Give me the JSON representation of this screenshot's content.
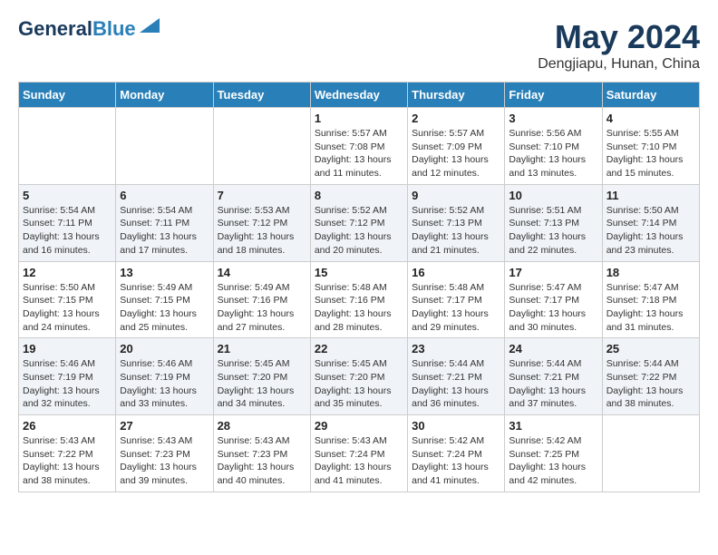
{
  "header": {
    "logo_line1": "General",
    "logo_line2": "Blue",
    "main_title": "May 2024",
    "subtitle": "Dengjiapu, Hunan, China"
  },
  "weekdays": [
    "Sunday",
    "Monday",
    "Tuesday",
    "Wednesday",
    "Thursday",
    "Friday",
    "Saturday"
  ],
  "weeks": [
    [
      {
        "day": "",
        "info": ""
      },
      {
        "day": "",
        "info": ""
      },
      {
        "day": "",
        "info": ""
      },
      {
        "day": "1",
        "info": "Sunrise: 5:57 AM\nSunset: 7:08 PM\nDaylight: 13 hours\nand 11 minutes."
      },
      {
        "day": "2",
        "info": "Sunrise: 5:57 AM\nSunset: 7:09 PM\nDaylight: 13 hours\nand 12 minutes."
      },
      {
        "day": "3",
        "info": "Sunrise: 5:56 AM\nSunset: 7:10 PM\nDaylight: 13 hours\nand 13 minutes."
      },
      {
        "day": "4",
        "info": "Sunrise: 5:55 AM\nSunset: 7:10 PM\nDaylight: 13 hours\nand 15 minutes."
      }
    ],
    [
      {
        "day": "5",
        "info": "Sunrise: 5:54 AM\nSunset: 7:11 PM\nDaylight: 13 hours\nand 16 minutes."
      },
      {
        "day": "6",
        "info": "Sunrise: 5:54 AM\nSunset: 7:11 PM\nDaylight: 13 hours\nand 17 minutes."
      },
      {
        "day": "7",
        "info": "Sunrise: 5:53 AM\nSunset: 7:12 PM\nDaylight: 13 hours\nand 18 minutes."
      },
      {
        "day": "8",
        "info": "Sunrise: 5:52 AM\nSunset: 7:12 PM\nDaylight: 13 hours\nand 20 minutes."
      },
      {
        "day": "9",
        "info": "Sunrise: 5:52 AM\nSunset: 7:13 PM\nDaylight: 13 hours\nand 21 minutes."
      },
      {
        "day": "10",
        "info": "Sunrise: 5:51 AM\nSunset: 7:13 PM\nDaylight: 13 hours\nand 22 minutes."
      },
      {
        "day": "11",
        "info": "Sunrise: 5:50 AM\nSunset: 7:14 PM\nDaylight: 13 hours\nand 23 minutes."
      }
    ],
    [
      {
        "day": "12",
        "info": "Sunrise: 5:50 AM\nSunset: 7:15 PM\nDaylight: 13 hours\nand 24 minutes."
      },
      {
        "day": "13",
        "info": "Sunrise: 5:49 AM\nSunset: 7:15 PM\nDaylight: 13 hours\nand 25 minutes."
      },
      {
        "day": "14",
        "info": "Sunrise: 5:49 AM\nSunset: 7:16 PM\nDaylight: 13 hours\nand 27 minutes."
      },
      {
        "day": "15",
        "info": "Sunrise: 5:48 AM\nSunset: 7:16 PM\nDaylight: 13 hours\nand 28 minutes."
      },
      {
        "day": "16",
        "info": "Sunrise: 5:48 AM\nSunset: 7:17 PM\nDaylight: 13 hours\nand 29 minutes."
      },
      {
        "day": "17",
        "info": "Sunrise: 5:47 AM\nSunset: 7:17 PM\nDaylight: 13 hours\nand 30 minutes."
      },
      {
        "day": "18",
        "info": "Sunrise: 5:47 AM\nSunset: 7:18 PM\nDaylight: 13 hours\nand 31 minutes."
      }
    ],
    [
      {
        "day": "19",
        "info": "Sunrise: 5:46 AM\nSunset: 7:19 PM\nDaylight: 13 hours\nand 32 minutes."
      },
      {
        "day": "20",
        "info": "Sunrise: 5:46 AM\nSunset: 7:19 PM\nDaylight: 13 hours\nand 33 minutes."
      },
      {
        "day": "21",
        "info": "Sunrise: 5:45 AM\nSunset: 7:20 PM\nDaylight: 13 hours\nand 34 minutes."
      },
      {
        "day": "22",
        "info": "Sunrise: 5:45 AM\nSunset: 7:20 PM\nDaylight: 13 hours\nand 35 minutes."
      },
      {
        "day": "23",
        "info": "Sunrise: 5:44 AM\nSunset: 7:21 PM\nDaylight: 13 hours\nand 36 minutes."
      },
      {
        "day": "24",
        "info": "Sunrise: 5:44 AM\nSunset: 7:21 PM\nDaylight: 13 hours\nand 37 minutes."
      },
      {
        "day": "25",
        "info": "Sunrise: 5:44 AM\nSunset: 7:22 PM\nDaylight: 13 hours\nand 38 minutes."
      }
    ],
    [
      {
        "day": "26",
        "info": "Sunrise: 5:43 AM\nSunset: 7:22 PM\nDaylight: 13 hours\nand 38 minutes."
      },
      {
        "day": "27",
        "info": "Sunrise: 5:43 AM\nSunset: 7:23 PM\nDaylight: 13 hours\nand 39 minutes."
      },
      {
        "day": "28",
        "info": "Sunrise: 5:43 AM\nSunset: 7:23 PM\nDaylight: 13 hours\nand 40 minutes."
      },
      {
        "day": "29",
        "info": "Sunrise: 5:43 AM\nSunset: 7:24 PM\nDaylight: 13 hours\nand 41 minutes."
      },
      {
        "day": "30",
        "info": "Sunrise: 5:42 AM\nSunset: 7:24 PM\nDaylight: 13 hours\nand 41 minutes."
      },
      {
        "day": "31",
        "info": "Sunrise: 5:42 AM\nSunset: 7:25 PM\nDaylight: 13 hours\nand 42 minutes."
      },
      {
        "day": "",
        "info": ""
      }
    ]
  ]
}
